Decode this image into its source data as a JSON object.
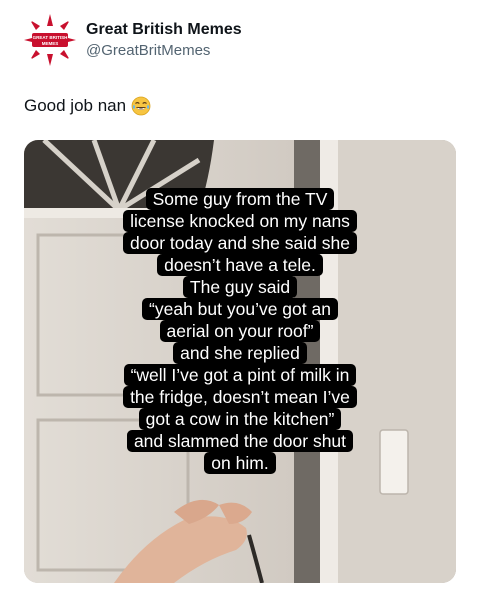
{
  "author": {
    "name": "Great British Memes",
    "handle": "@GreatBritMemes",
    "avatar_text": "GREAT BRITISH MEMES"
  },
  "post": {
    "text": "Good job nan",
    "emoji": "tears-of-joy-emoji"
  },
  "media": {
    "caption_lines": [
      "Some guy from the TV",
      "license knocked on my nans",
      "door today and she said she",
      "doesn’t have a tele.",
      "The guy said",
      "“yeah but you’ve got an",
      "aerial on your roof”",
      "and she replied",
      "“well I’ve got a pint of milk in",
      "the fridge, doesn’t mean I’ve",
      "got a cow in the kitchen”",
      "and slammed the door shut",
      "on him."
    ]
  },
  "colors": {
    "brand_red": "#c8102e",
    "brand_navy": "#012169",
    "text_primary": "#0f1419",
    "text_secondary": "#536471",
    "caption_bg": "#000000",
    "caption_text": "#ffffff"
  }
}
